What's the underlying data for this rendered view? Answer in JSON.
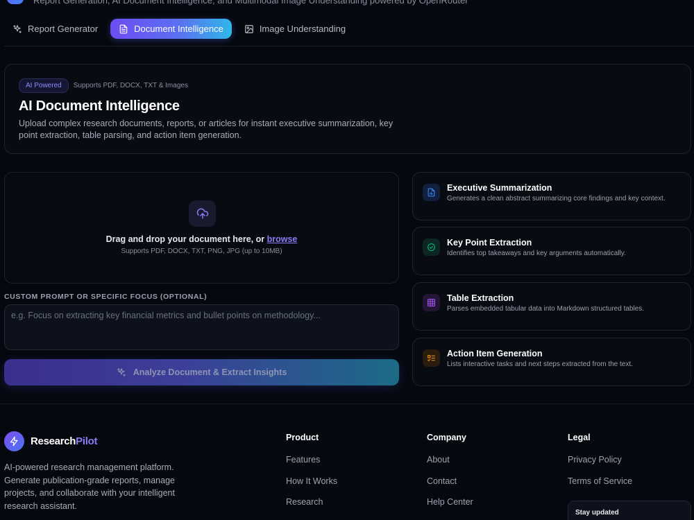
{
  "header": {
    "subtitle": "Report Generation, AI Document Intelligence, and Multimodal Image Understanding powered by OpenRouter"
  },
  "tabs": [
    {
      "label": "Report Generator",
      "icon": "sparkles-icon",
      "active": false
    },
    {
      "label": "Document Intelligence",
      "icon": "document-icon",
      "active": true
    },
    {
      "label": "Image Understanding",
      "icon": "image-icon",
      "active": false
    }
  ],
  "hero": {
    "badge": "AI Powered",
    "badge_note": "Supports PDF, DOCX, TXT & Images",
    "title": "AI Document Intelligence",
    "description": "Upload complex research documents, reports, or articles for instant executive summarization, key point extraction, table parsing, and action item generation."
  },
  "dropzone": {
    "text": "Drag and drop your document here, or",
    "browse_link": "browse",
    "subtext": "Supports PDF, DOCX, TXT, PNG, JPG (up to 10MB)"
  },
  "prompt": {
    "label": "CUSTOM PROMPT OR SPECIFIC FOCUS (OPTIONAL)",
    "placeholder": "e.g. Focus on extracting key financial metrics and bullet points on methodology...",
    "value": ""
  },
  "analyze_button": {
    "label": "Analyze Document & Extract Insights"
  },
  "features": [
    {
      "title": "Executive Summarization",
      "description": "Generates a clean abstract summarizing core findings and key context.",
      "icon": "file-chart-icon",
      "color": "#3b82f6",
      "bg": "#10203d"
    },
    {
      "title": "Key Point Extraction",
      "description": "Identifies top takeaways and key arguments automatically.",
      "icon": "check-circle-icon",
      "color": "#10b981",
      "bg": "#0c2623"
    },
    {
      "title": "Table Extraction",
      "description": "Parses embedded tabular data into Markdown structured tables.",
      "icon": "table-icon",
      "color": "#a855f7",
      "bg": "#231536"
    },
    {
      "title": "Action Item Generation",
      "description": "Lists interactive tasks and next steps extracted from the text.",
      "icon": "list-icon",
      "color": "#f59e0b",
      "bg": "#2a1d0e"
    }
  ],
  "footer": {
    "brand_prefix": "Research",
    "brand_accent": "Pilot",
    "description": "AI-powered research management platform. Generate publication-grade reports, manage projects, and collaborate with your intelligent research assistant.",
    "columns": [
      {
        "title": "Product",
        "links": [
          "Features",
          "How It Works",
          "Research"
        ]
      },
      {
        "title": "Company",
        "links": [
          "About",
          "Contact",
          "Help Center"
        ]
      },
      {
        "title": "Legal",
        "links": [
          "Privacy Policy",
          "Terms of Service"
        ]
      }
    ],
    "newsletter_label": "Stay updated"
  }
}
